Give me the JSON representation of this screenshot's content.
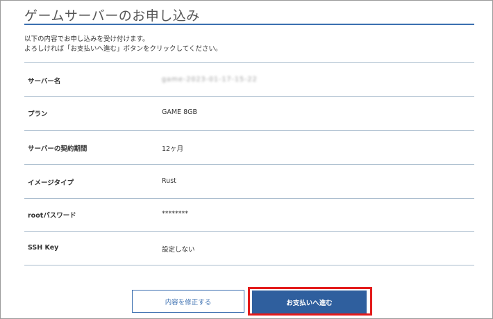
{
  "page": {
    "title": "ゲームサーバーのお申し込み",
    "intro_line1": "以下の内容でお申し込みを受け付けます。",
    "intro_line2": "よろしければ「お支払いへ進む」ボタンをクリックしてください。"
  },
  "rows": [
    {
      "label": "サーバー名",
      "value": "game-2023-01-17-15-22"
    },
    {
      "label": "プラン",
      "value": "GAME 8GB"
    },
    {
      "label": "サーバーの契約期間",
      "value": "12ヶ月"
    },
    {
      "label": "イメージタイプ",
      "value": "Rust"
    },
    {
      "label": "rootパスワード",
      "value": "********"
    },
    {
      "label": "SSH Key",
      "value": "設定しない"
    }
  ],
  "buttons": {
    "edit_label": "内容を修正する",
    "pay_label": "お支払いへ進む"
  },
  "colors": {
    "accent": "#3b6fb0",
    "primary_button": "#2f5f9e",
    "highlight": "#e31b1b"
  }
}
